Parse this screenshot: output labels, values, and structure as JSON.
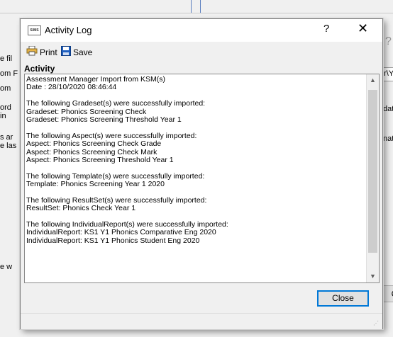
{
  "background": {
    "fragments": [
      "e fil",
      "om F",
      "om",
      "ord",
      "in",
      "s ar",
      "e las",
      "e w"
    ],
    "field_right_text": "er\\Y",
    "side_texts": [
      "data",
      "natio"
    ],
    "button_partial": "C",
    "help_char": "?"
  },
  "dialog": {
    "logo_text": "SIMS",
    "title": "Activity Log",
    "help_label": "?",
    "close_label": "✕",
    "toolbar": {
      "print_label": "Print",
      "save_label": "Save"
    },
    "activity_header": "Activity",
    "log_lines": [
      "Assessment Manager Import from KSM(s)",
      "Date : 28/10/2020 08:46:44",
      "",
      "The following Gradeset(s) were successfully imported:",
      "Gradeset: Phonics Screening Check",
      "Gradeset: Phonics Screening Threshold Year 1",
      "",
      "The following Aspect(s) were successfully imported:",
      "Aspect: Phonics Screening Check Grade",
      "Aspect: Phonics Screening Check Mark",
      "Aspect: Phonics Screening Threshold Year 1",
      "",
      "The following Template(s) were successfully imported:",
      "Template: Phonics Screening Year 1 2020",
      "",
      "The following ResultSet(s) were successfully imported:",
      "ResultSet: Phonics Check Year 1",
      "",
      "The following IndividualReport(s) were successfully imported:",
      "IndividualReport: KS1 Y1 Phonics Comparative Eng 2020",
      "IndividualReport: KS1 Y1 Phonics Student Eng 2020"
    ],
    "close_button_label": "Close"
  }
}
